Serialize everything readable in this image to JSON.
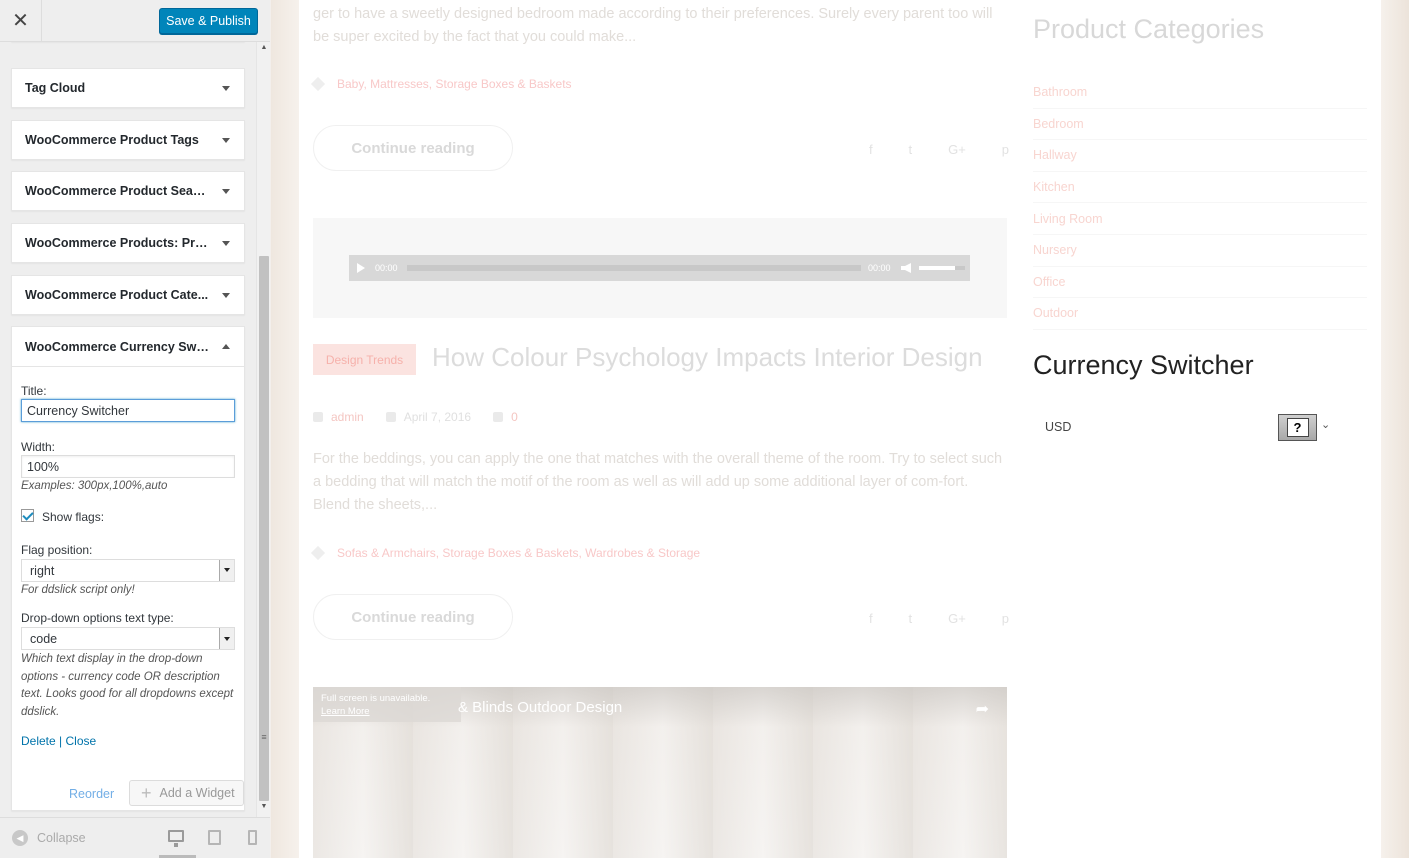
{
  "topbar": {
    "close_label": "✕",
    "save_label": "Save & Publish"
  },
  "widgets": [
    {
      "title": "Tag Cloud"
    },
    {
      "title": "WooCommerce Product Tags"
    },
    {
      "title": "WooCommerce Product Search"
    },
    {
      "title": "WooCommerce Products: Pro..."
    },
    {
      "title": "WooCommerce Product Cate..."
    }
  ],
  "open_widget": {
    "title": "WooCommerce Currency Swit...",
    "fields": {
      "title_label": "Title:",
      "title_value": "Currency Switcher",
      "width_label": "Width:",
      "width_value": "100%",
      "width_desc": "Examples: 300px,100%,auto",
      "show_flags_label": "Show flags:",
      "show_flags_checked": true,
      "flag_position_label": "Flag position:",
      "flag_position_value": "right",
      "flag_position_desc": "For ddslick script only!",
      "dropdown_label": "Drop-down options text type:",
      "dropdown_value": "code",
      "dropdown_desc": "Which text display in the drop-down options - currency code OR description text. Looks good for all dropdowns except ddslick."
    },
    "delete_label": "Delete",
    "separator": "|",
    "close_label": "Close"
  },
  "actions": {
    "reorder_label": "Reorder",
    "add_widget_label": "Add a Widget"
  },
  "footer": {
    "collapse_label": "Collapse",
    "devices": [
      "desktop-icon",
      "tablet-icon",
      "mobile-icon"
    ]
  },
  "preview": {
    "post1": {
      "excerpt": "ger to have a sweetly designed bedroom made according to their preferences. Surely every parent too will be super excited by the fact that you could make...",
      "tags": "Baby, Mattresses, Storage Boxes & Baskets",
      "continue_label": "Continue reading"
    },
    "audio": {
      "start_time": "00:00",
      "end_time": "00:00"
    },
    "post2": {
      "category": "Design Trends",
      "title": "How Colour Psychology Impacts Interior Design",
      "author": "admin",
      "date": "April 7, 2016",
      "comments": "0",
      "excerpt": "For the beddings, you can apply the one that matches with the overall theme of the room. Try to select such a bedding that will match the motif of the room as well as will add up some additional layer of com-fort. Blend the sheets,...",
      "tags": "Sofas & Armchairs, Storage Boxes & Baskets, Wardrobes & Storage",
      "continue_label": "Continue reading"
    },
    "video": {
      "notice_line1": "Full screen is unavailable.",
      "notice_line2": "Learn More",
      "title": "& Blinds Outdoor Design"
    },
    "social_icons": [
      "f",
      "t",
      "G+",
      "p"
    ],
    "sidebar": {
      "categories_title": "Product Categories",
      "categories": [
        "Bathroom",
        "Bedroom",
        "Hallway",
        "Kitchen",
        "Living Room",
        "Nursery",
        "Office",
        "Outdoor"
      ],
      "currency_title": "Currency Switcher",
      "currency_value": "USD",
      "flag_glyph": "?"
    }
  },
  "colors": {
    "primary_button": "#0085ba",
    "link": "#0073aa",
    "panel_bg": "#eeeeee"
  }
}
